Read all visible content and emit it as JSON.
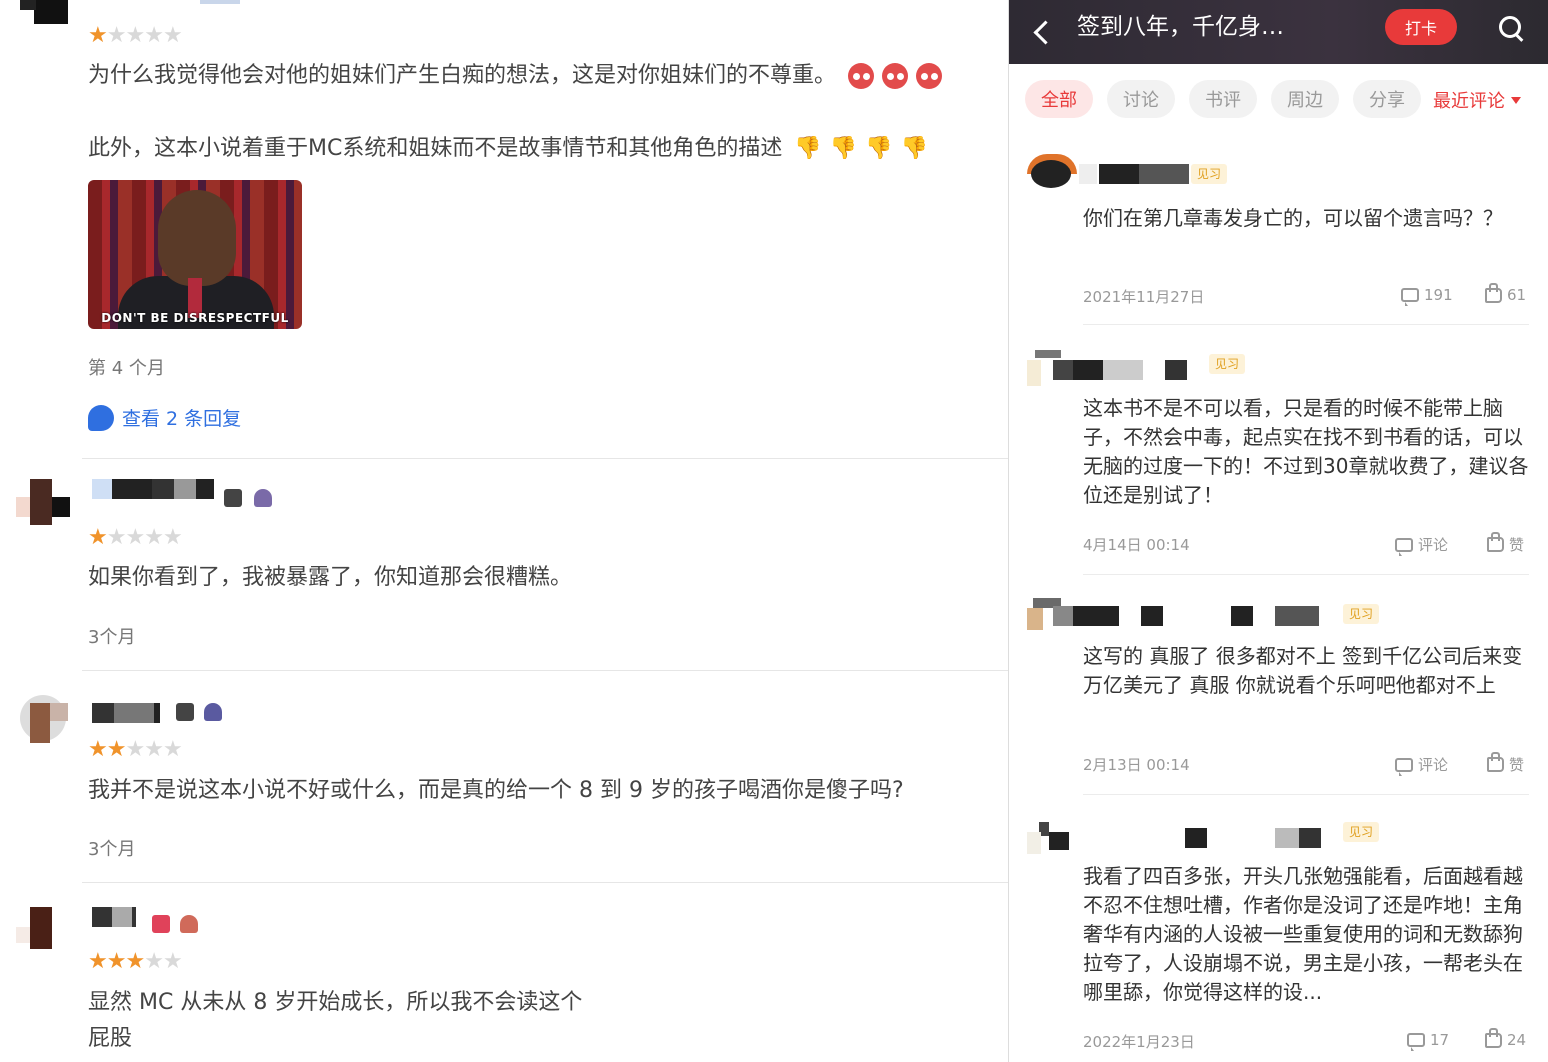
{
  "left": {
    "reviews": [
      {
        "stars": 1,
        "text_line1": "为什么我觉得他会对他的姐妹们产生白痴的想法，这是对你姐妹们的不尊重。",
        "text_line2": "此外，这本小说着重于MC系统和姐妹而不是故事情节和其他角色的描述",
        "image_caption": "DON'T BE DISRESPECTFUL",
        "time": "第 4 个月",
        "replies_label": "查看 2 条回复"
      },
      {
        "stars": 1,
        "text_line1": "如果你看到了，我被暴露了，你知道那会很糟糕。",
        "time": "3个月"
      },
      {
        "stars": 2,
        "text_line1": "我并不是说这本小说不好或什么，而是真的给一个 8 到 9 岁的孩子喝酒你是傻子吗?",
        "time": "3个月"
      },
      {
        "stars": 3,
        "text_line1": "显然 MC 从未从 8 岁开始成长，所以我不会读这个",
        "text_line2": "屁股"
      }
    ]
  },
  "right": {
    "header": {
      "title": "签到八年，千亿身…",
      "checkin_label": "打卡"
    },
    "tabs": [
      {
        "label": "全部",
        "active": true
      },
      {
        "label": "讨论"
      },
      {
        "label": "书评"
      },
      {
        "label": "周边"
      },
      {
        "label": "分享"
      }
    ],
    "sort_label": "最近评论",
    "comments": [
      {
        "level": "见习",
        "text": "你们在第几章毒发身亡的，可以留个遗言吗？？",
        "date": "2021年11月27日",
        "comments": "191",
        "likes": "61"
      },
      {
        "level": "见习",
        "text": "这本书不是不可以看，只是看的时候不能带上脑子，不然会中毒，起点实在找不到书看的话，可以无脑的过度一下的！不过到30章就收费了，建议各位还是别试了！",
        "date": "4月14日 00:14",
        "comments": "评论",
        "likes": "赞"
      },
      {
        "level": "见习",
        "text": "这写的  真服了  很多都对不上  签到千亿公司后来变万亿美元了  真服  你就说看个乐呵吧他都对不上",
        "date": "2月13日 00:14",
        "comments": "评论",
        "likes": "赞"
      },
      {
        "level": "见习",
        "text": "我看了四百多张，开头几张勉强能看，后面越看越不忍不住想吐槽，作者你是没词了还是咋地！主角奢华有内涵的人设被一些重复使用的词和无数舔狗拉夸了，人设崩塌不说，男主是小孩，一帮老头在哪里舔，你觉得这样的设...",
        "date": "2022年1月23日",
        "comments": "17",
        "likes": "24"
      }
    ]
  },
  "colors": {
    "accent_red": "#e83a3a",
    "star_orange": "#f0932b",
    "link_blue": "#2f6fe0",
    "level_badge": "#e0a020"
  }
}
